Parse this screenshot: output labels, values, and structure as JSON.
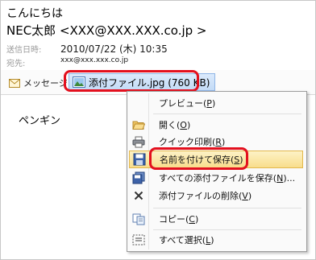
{
  "header": {
    "greeting": "こんにちは",
    "from": "NEC太郎 <XXX@XXX.XXX.co.jp >",
    "sent_label": "送信日時:",
    "sent_value": "2010/07/22 (木) 10:35",
    "to_label": "宛先:",
    "to_value": "xxx@xxx.xxx.co.jp"
  },
  "attachments": {
    "message_tab": "メッセージ",
    "file": "添付ファイル.jpg (760 KB)"
  },
  "body": {
    "text": "ペンギン"
  },
  "context_menu": {
    "items": [
      {
        "prefix": "プレビュー(",
        "key": "P",
        "suffix": ")",
        "icon": "preview-icon"
      },
      {
        "prefix": "開く(",
        "key": "O",
        "suffix": ")",
        "icon": "open-folder-icon"
      },
      {
        "prefix": "クイック印刷(",
        "key": "R",
        "suffix": ")",
        "icon": "printer-icon"
      },
      {
        "prefix": "名前を付けて保存(",
        "key": "S",
        "suffix": ")",
        "icon": "save-icon"
      },
      {
        "prefix": "すべての添付ファイルを保存(",
        "key": "N",
        "suffix": ")...",
        "icon": "save-all-icon"
      },
      {
        "prefix": "添付ファイルの削除(",
        "key": "V",
        "suffix": ")",
        "icon": "delete-x-icon"
      },
      {
        "prefix": "コピー(",
        "key": "C",
        "suffix": ")",
        "icon": "copy-icon"
      },
      {
        "prefix": "すべて選択(",
        "key": "L",
        "suffix": ")",
        "icon": "select-all-icon"
      }
    ],
    "selected_index": 3
  },
  "colors": {
    "highlight_red": "#e3101e",
    "selected_bg": "#f8dd8c",
    "attachment_chip": "#c3dbf6"
  }
}
